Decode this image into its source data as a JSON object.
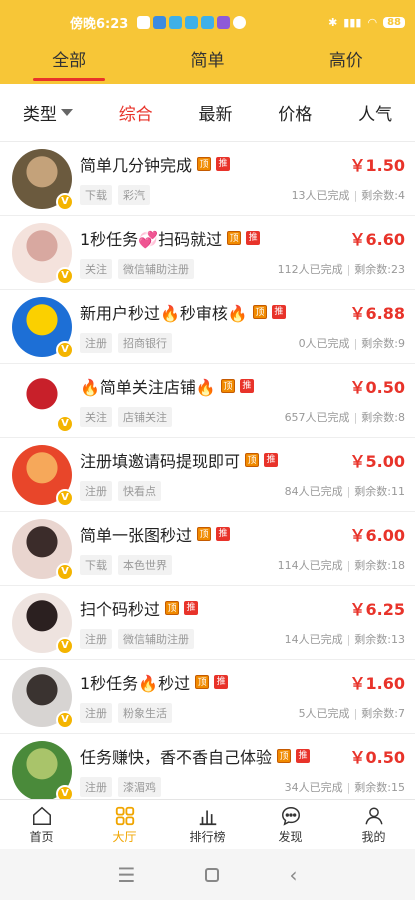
{
  "status": {
    "time": "傍晚6:23",
    "battery": "88"
  },
  "top_tabs": [
    {
      "label": "全部",
      "active": true
    },
    {
      "label": "简单",
      "active": false
    },
    {
      "label": "高价",
      "active": false
    }
  ],
  "filters": [
    {
      "label": "类型"
    },
    {
      "label": "综合"
    },
    {
      "label": "最新"
    },
    {
      "label": "价格"
    },
    {
      "label": "人气"
    }
  ],
  "tasks": [
    {
      "title": "简单几分钟完成",
      "price": "￥1.50",
      "tags": [
        "下载",
        "彩汽"
      ],
      "done": "13人已完成",
      "remain": "剩余数:4",
      "avatar_colors": [
        "#6b5a3e",
        "#c4a27a"
      ]
    },
    {
      "title": "1秒任务💞扫码就过",
      "price": "￥6.60",
      "tags": [
        "关注",
        "微信辅助注册"
      ],
      "done": "112人已完成",
      "remain": "剩余数:23",
      "avatar_colors": [
        "#f4e2dc",
        "#d8a8a0"
      ]
    },
    {
      "title": "新用户秒过🔥秒审核🔥",
      "price": "￥6.88",
      "tags": [
        "注册",
        "招商银行"
      ],
      "done": "0人已完成",
      "remain": "剩余数:9",
      "avatar_colors": [
        "#1d6fd6",
        "#fbd000"
      ]
    },
    {
      "title": "🔥简单关注店铺🔥",
      "price": "￥0.50",
      "tags": [
        "关注",
        "店铺关注"
      ],
      "done": "657人已完成",
      "remain": "剩余数:8",
      "avatar_colors": [
        "#ffffff",
        "#c8202a"
      ]
    },
    {
      "title": "注册填邀请码提现即可",
      "price": "￥5.00",
      "tags": [
        "注册",
        "快看点"
      ],
      "done": "84人已完成",
      "remain": "剩余数:11",
      "avatar_colors": [
        "#e8462a",
        "#f6a85a"
      ]
    },
    {
      "title": "简单一张图秒过",
      "price": "￥6.00",
      "tags": [
        "下载",
        "本色世界"
      ],
      "done": "114人已完成",
      "remain": "剩余数:18",
      "avatar_colors": [
        "#e9d5cf",
        "#3b2c2a"
      ]
    },
    {
      "title": "扫个码秒过",
      "price": "￥6.25",
      "tags": [
        "注册",
        "微信辅助注册"
      ],
      "done": "14人已完成",
      "remain": "剩余数:13",
      "avatar_colors": [
        "#eee3df",
        "#2b2020"
      ]
    },
    {
      "title": "1秒任务🔥秒过",
      "price": "￥1.60",
      "tags": [
        "注册",
        "粉象生活"
      ],
      "done": "5人已完成",
      "remain": "剩余数:7",
      "avatar_colors": [
        "#d7d4d2",
        "#3a3330"
      ]
    },
    {
      "title": "任务赚快，香不香自己体验",
      "price": "￥0.50",
      "tags": [
        "注册",
        "漆湄鸡"
      ],
      "done": "34人已完成",
      "remain": "剩余数:15",
      "avatar_colors": [
        "#4a8a3a",
        "#a9c46a"
      ]
    }
  ],
  "badges": {
    "top": "顶",
    "rec": "推",
    "vip": "V"
  },
  "bottom_nav": [
    {
      "label": "首页",
      "icon": "home-icon",
      "active": false
    },
    {
      "label": "大厅",
      "icon": "grid-icon",
      "active": true
    },
    {
      "label": "排行榜",
      "icon": "bar-chart-icon",
      "active": false
    },
    {
      "label": "发现",
      "icon": "chat-icon",
      "active": false
    },
    {
      "label": "我的",
      "icon": "person-icon",
      "active": false
    }
  ],
  "colors": {
    "brand": "#f7c637",
    "accent": "#e8332a",
    "nav_active": "#f0a500"
  }
}
